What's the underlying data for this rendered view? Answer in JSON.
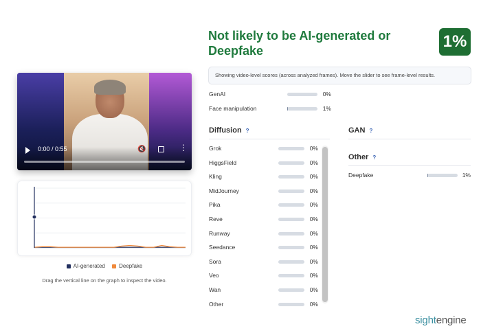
{
  "verdict": {
    "title": "Not likely to be AI-generated or Deepfake",
    "score_badge": "1%",
    "color": "#1f7a3d"
  },
  "info_text": "Showing video-level scores (across analyzed frames). Move the slider to see frame-level results.",
  "top_scores": [
    {
      "label": "GenAI",
      "value": "0%",
      "fraction": 0.0
    },
    {
      "label": "Face manipulation",
      "value": "1%",
      "fraction": 0.01
    }
  ],
  "diffusion": {
    "title": "Diffusion",
    "help_icon": "?",
    "items": [
      {
        "label": "Grok",
        "value": "0%",
        "fraction": 0.0
      },
      {
        "label": "HiggsField",
        "value": "0%",
        "fraction": 0.0
      },
      {
        "label": "Kling",
        "value": "0%",
        "fraction": 0.0
      },
      {
        "label": "MidJourney",
        "value": "0%",
        "fraction": 0.0
      },
      {
        "label": "Pika",
        "value": "0%",
        "fraction": 0.0
      },
      {
        "label": "Reve",
        "value": "0%",
        "fraction": 0.0
      },
      {
        "label": "Runway",
        "value": "0%",
        "fraction": 0.0
      },
      {
        "label": "Seedance",
        "value": "0%",
        "fraction": 0.0
      },
      {
        "label": "Sora",
        "value": "0%",
        "fraction": 0.0
      },
      {
        "label": "Veo",
        "value": "0%",
        "fraction": 0.0
      },
      {
        "label": "Wan",
        "value": "0%",
        "fraction": 0.0
      },
      {
        "label": "Other",
        "value": "0%",
        "fraction": 0.0
      }
    ]
  },
  "gan": {
    "title": "GAN",
    "help_icon": "?"
  },
  "other": {
    "title": "Other",
    "help_icon": "?",
    "items": [
      {
        "label": "Deepfake",
        "value": "1%",
        "fraction": 0.01
      }
    ]
  },
  "video": {
    "time": "0:00 / 0:55",
    "play_icon": "play-icon",
    "mute_icon": "mute-icon",
    "fullscreen_icon": "fullscreen-icon",
    "more_icon": "more-vertical-icon"
  },
  "legend": [
    {
      "label": "AI-generated",
      "color": "#23305f"
    },
    {
      "label": "Deepfake",
      "color": "#f08a3c"
    }
  ],
  "hint": "Drag the vertical line on the graph to inspect the video.",
  "chart_data": {
    "type": "line",
    "ylim": [
      0,
      1
    ],
    "grid": true,
    "series": [
      {
        "name": "AI-generated",
        "color": "#23305f",
        "values": [
          0.01,
          0.01,
          0.01,
          0.01,
          0.01,
          0.01,
          0.01,
          0.01,
          0.01,
          0.01,
          0.01,
          0.01,
          0.01,
          0.01,
          0.01,
          0.01,
          0.01,
          0.01,
          0.01,
          0.01
        ]
      },
      {
        "name": "Deepfake",
        "color": "#f08a3c",
        "values": [
          0.01,
          0.02,
          0.02,
          0.01,
          0.01,
          0.01,
          0.01,
          0.01,
          0.01,
          0.01,
          0.01,
          0.03,
          0.04,
          0.03,
          0.01,
          0.01,
          0.04,
          0.02,
          0.01,
          0.01
        ]
      }
    ]
  },
  "brand": {
    "part1": "sight",
    "part2": "engine"
  }
}
